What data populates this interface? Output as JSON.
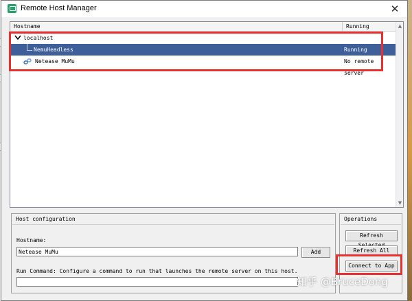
{
  "window": {
    "title": "Remote Host Manager",
    "close_glyph": "✕",
    "app_icon": "window-app-icon"
  },
  "tree": {
    "headers": {
      "hostname": "Hostname",
      "running": "Running"
    },
    "rows": [
      {
        "hostname": "localhost",
        "running": "",
        "expanded": true
      },
      {
        "hostname": "NemuHeadless",
        "running": "Running",
        "selected": true
      },
      {
        "hostname": "Netease MuMu",
        "running": "No remote server"
      }
    ],
    "selection_color": "#3e5f9a",
    "scroll_up_glyph": "▲",
    "scroll_down_glyph": "▼"
  },
  "host_config": {
    "title": "Host configuration",
    "hostname_label": "Hostname:",
    "hostname_value": "Netease MuMu",
    "add_label": "Add",
    "run_command_label": "Run Command: Configure a command to run that launches the remote server on this host.",
    "run_command_value": ""
  },
  "operations": {
    "title": "Operations",
    "refresh_selected": "Refresh Selected",
    "refresh_all": "Refresh All",
    "connect": "Connect to App"
  },
  "annotation_color": "#e8312f",
  "watermark": "知乎 @BruceDong"
}
